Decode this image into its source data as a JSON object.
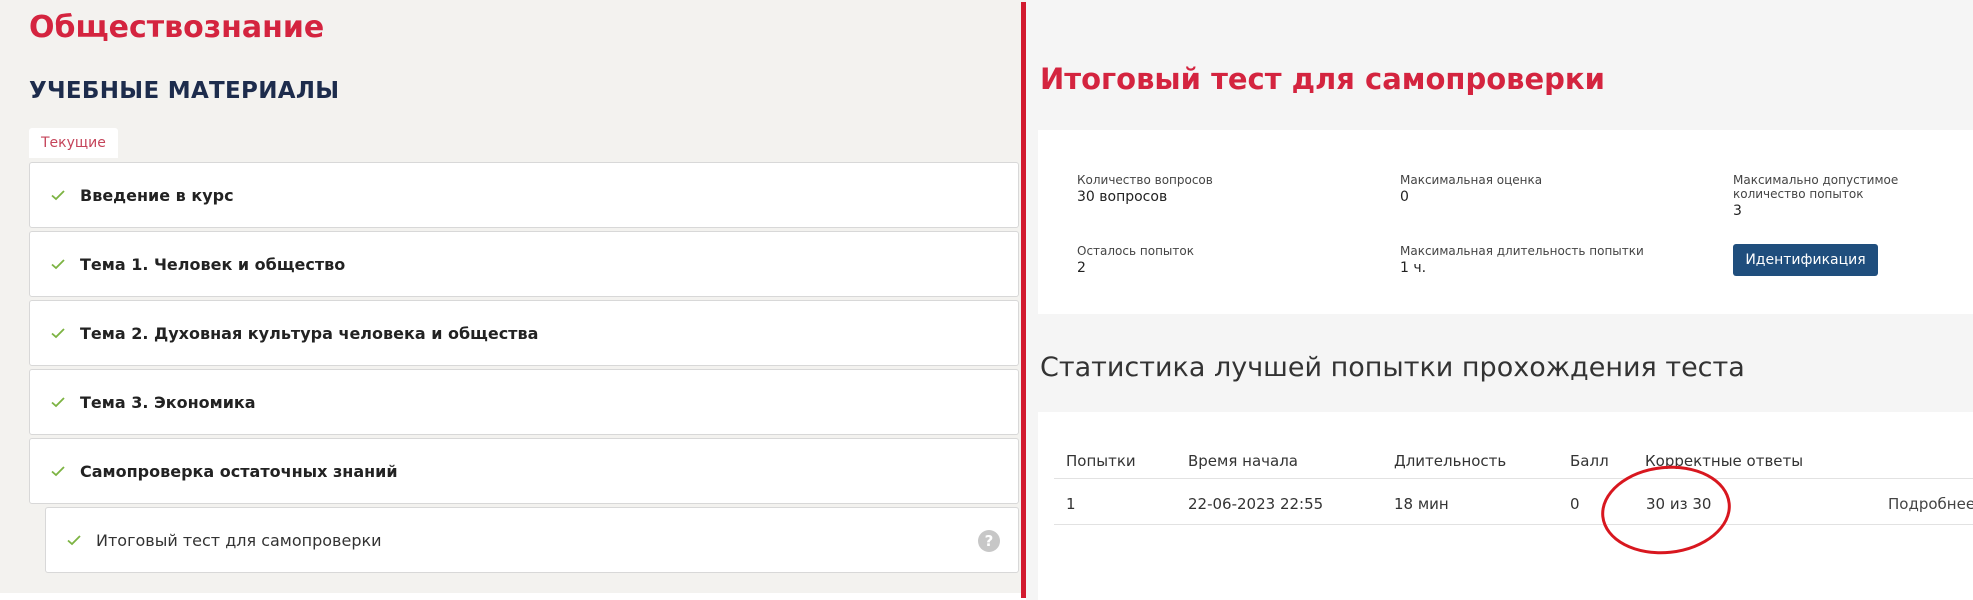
{
  "left": {
    "course_title": "Обществознание",
    "section_title": "УЧЕБНЫЕ МАТЕРИАЛЫ",
    "tab_current": "Текущие",
    "modules": [
      {
        "label": "Введение в курс"
      },
      {
        "label": "Тема 1. Человек и общество"
      },
      {
        "label": "Тема 2. Духовная культура человека и общества"
      },
      {
        "label": "Тема 3. Экономика"
      },
      {
        "label": "Самопроверка остаточных знаний"
      }
    ],
    "sub_module": {
      "label": "Итоговый тест для самопроверки",
      "help": "?"
    }
  },
  "right": {
    "test_title": "Итоговый тест для самопроверки",
    "info": {
      "questions_label": "Количество вопросов",
      "questions_value": "30 вопросов",
      "max_score_label": "Максимальная оценка",
      "max_score_value": "0",
      "max_attempts_label": "Максимально допустимое количество попыток",
      "max_attempts_value": "3",
      "remaining_label": "Осталось попыток",
      "remaining_value": "2",
      "max_duration_label": "Максимальная длительность попытки",
      "max_duration_value": "1 ч.",
      "ident_button": "Идентификация"
    },
    "stats": {
      "title": "Статистика лучшей попытки прохождения теста",
      "headers": [
        "Попытки",
        "Время начала",
        "Длительность",
        "Балл",
        "Корректные ответы"
      ],
      "row": {
        "attempt": "1",
        "start": "22-06-2023 22:55",
        "duration": "18 мин",
        "score": "0",
        "correct": "30 из 30",
        "details": "Подробнее"
      }
    }
  },
  "colors": {
    "accent_red": "#d4243f",
    "navy": "#1d2c4c",
    "button_blue": "#1f4e7d",
    "check_green": "#7cb342",
    "annotation_red": "#d8171f"
  }
}
